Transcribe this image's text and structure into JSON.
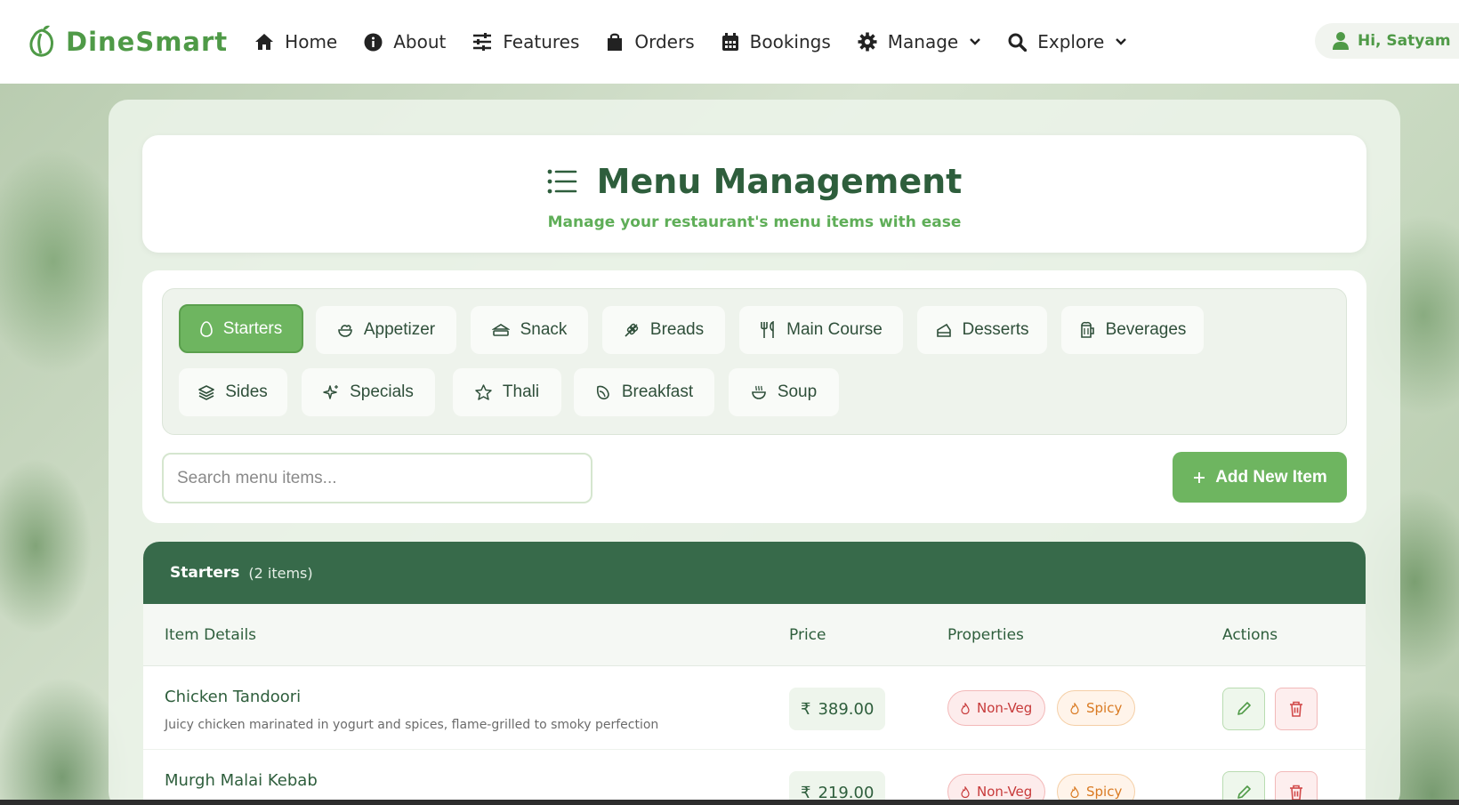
{
  "nav": {
    "brand": "DineSmart",
    "items": [
      {
        "label": "Home",
        "icon": "home-icon"
      },
      {
        "label": "About",
        "icon": "info-icon"
      },
      {
        "label": "Features",
        "icon": "sliders-icon"
      },
      {
        "label": "Orders",
        "icon": "shopping-bag-icon"
      },
      {
        "label": "Bookings",
        "icon": "calendar-icon"
      },
      {
        "label": "Manage",
        "icon": "gear-icon"
      },
      {
        "label": "Explore",
        "icon": "search-icon"
      }
    ],
    "user_greeting": "Hi, Satyam"
  },
  "header": {
    "title": "Menu Management",
    "subtitle": "Manage your restaurant's menu items with ease"
  },
  "categories": [
    {
      "label": "Starters",
      "icon": "egg-icon",
      "active": true
    },
    {
      "label": "Appetizer",
      "icon": "salad-icon"
    },
    {
      "label": "Snack",
      "icon": "sandwich-icon"
    },
    {
      "label": "Breads",
      "icon": "wheat-icon"
    },
    {
      "label": "Main Course",
      "icon": "utensils-icon"
    },
    {
      "label": "Desserts",
      "icon": "cake-slice-icon"
    },
    {
      "label": "Beverages",
      "icon": "beer-icon"
    },
    {
      "label": "Sides",
      "icon": "layers-icon"
    },
    {
      "label": "Specials",
      "icon": "sparkles-icon"
    },
    {
      "label": "Thali",
      "icon": "star-icon"
    },
    {
      "label": "Breakfast",
      "icon": "croissant-icon"
    },
    {
      "label": "Soup",
      "icon": "soup-icon"
    }
  ],
  "search": {
    "placeholder": "Search menu items..."
  },
  "add_button": "Add New Item",
  "table": {
    "category": "Starters",
    "count": "(2 items)",
    "columns": [
      "Item Details",
      "Price",
      "Properties",
      "Actions"
    ],
    "rows": [
      {
        "name": "Chicken Tandoori",
        "description": "Juicy chicken marinated in yogurt and spices, flame-grilled to smoky perfection",
        "price": "389.00",
        "tags": [
          "Non-Veg",
          "Spicy"
        ]
      },
      {
        "name": "Murgh Malai Kebab",
        "description": "",
        "price": "219.00",
        "tags": [
          "Non-Veg",
          "Spicy"
        ]
      }
    ]
  },
  "currency_symbol": "₹",
  "colors": {
    "brand_green": "#4f9a47",
    "accent_green": "#6eb560",
    "dark_green": "#376a4a",
    "nonveg_red": "#c73a3a",
    "spicy_orange": "#d97a22"
  }
}
